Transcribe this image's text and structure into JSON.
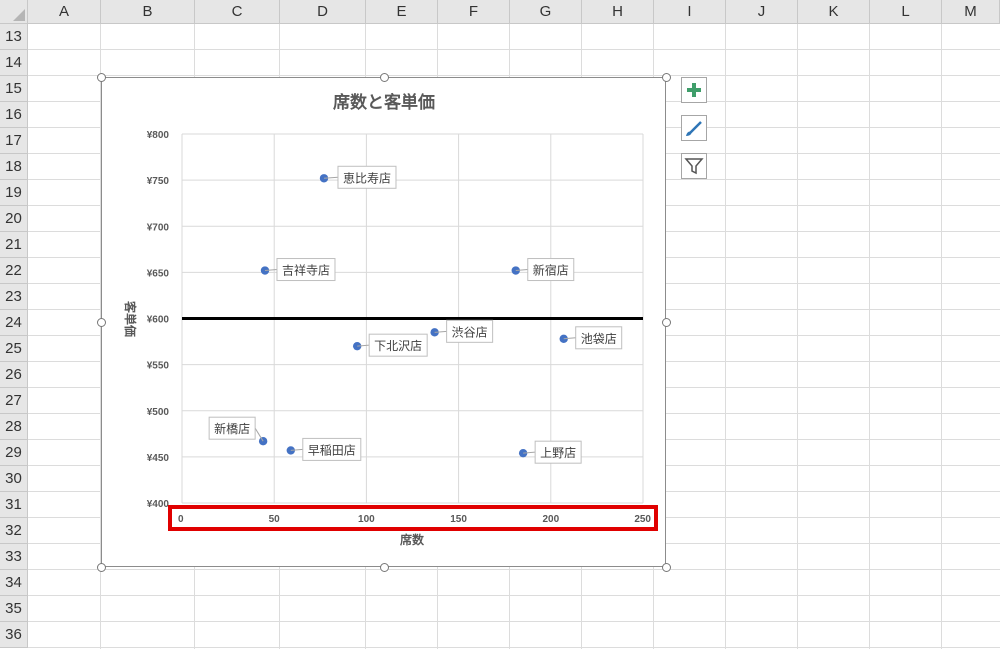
{
  "spreadsheet": {
    "columns": [
      "A",
      "B",
      "C",
      "D",
      "E",
      "F",
      "G",
      "H",
      "I",
      "J",
      "K",
      "L",
      "M"
    ],
    "rows": [
      "13",
      "14",
      "15",
      "16",
      "17",
      "18",
      "19",
      "20",
      "21",
      "22",
      "23",
      "24",
      "25",
      "26",
      "27",
      "28",
      "29",
      "30",
      "31",
      "32",
      "33",
      "34",
      "35",
      "36"
    ]
  },
  "chart_buttons": {
    "add_element_icon": "plus-icon",
    "style_icon": "brush-icon",
    "filter_icon": "funnel-icon"
  },
  "chart_data": {
    "type": "scatter",
    "title": "席数と客単価",
    "xlabel": "席数",
    "ylabel": "客単価",
    "xlim": [
      0,
      250
    ],
    "ylim": [
      400,
      800
    ],
    "x_ticks": [
      "0",
      "50",
      "100",
      "150",
      "200",
      "250"
    ],
    "y_ticks": [
      "¥400",
      "¥450",
      "¥500",
      "¥550",
      "¥600",
      "¥650",
      "¥700",
      "¥750",
      "¥800"
    ],
    "reference_line_y": 600,
    "grid": true,
    "marker_color": "#4472c4",
    "highlight_color": "#e00000",
    "points": [
      {
        "label": "恵比寿店",
        "x": 77,
        "y": 752
      },
      {
        "label": "吉祥寺店",
        "x": 45,
        "y": 652
      },
      {
        "label": "新宿店",
        "x": 181,
        "y": 652
      },
      {
        "label": "渋谷店",
        "x": 137,
        "y": 585
      },
      {
        "label": "池袋店",
        "x": 207,
        "y": 578
      },
      {
        "label": "下北沢店",
        "x": 95,
        "y": 570
      },
      {
        "label": "新橋店",
        "x": 44,
        "y": 467
      },
      {
        "label": "早稲田店",
        "x": 59,
        "y": 457
      },
      {
        "label": "上野店",
        "x": 185,
        "y": 454
      }
    ]
  }
}
